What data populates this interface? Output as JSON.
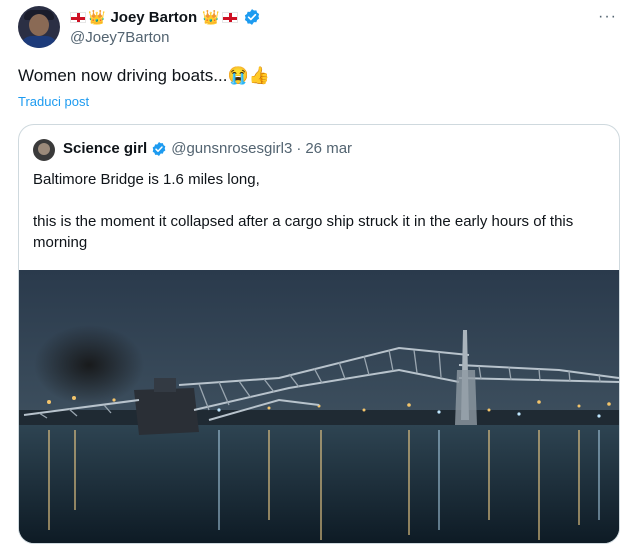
{
  "author": {
    "name": "Joey Barton",
    "handle": "@Joey7Barton",
    "crown_left": "👑",
    "crown_right": "👑"
  },
  "tweet": {
    "text": "Women now driving boats...😭👍",
    "translate_label": "Traduci post"
  },
  "more_label": "···",
  "quote": {
    "name": "Science girl",
    "handle": "@gunsnrosesgirl3",
    "separator": "·",
    "date": "26 mar",
    "line1": "Baltimore Bridge is 1.6 miles long,",
    "line2": "this is the moment it collapsed after a cargo ship struck it in the early hours of this morning"
  },
  "colors": {
    "verified": "#1d9bf0",
    "link": "#1d9bf0",
    "muted": "#536471",
    "border": "#cfd9de",
    "england_red": "#ce1124"
  },
  "icons": [
    "england-flag-icon",
    "crown-icon",
    "verified-badge-icon",
    "more-icon"
  ]
}
